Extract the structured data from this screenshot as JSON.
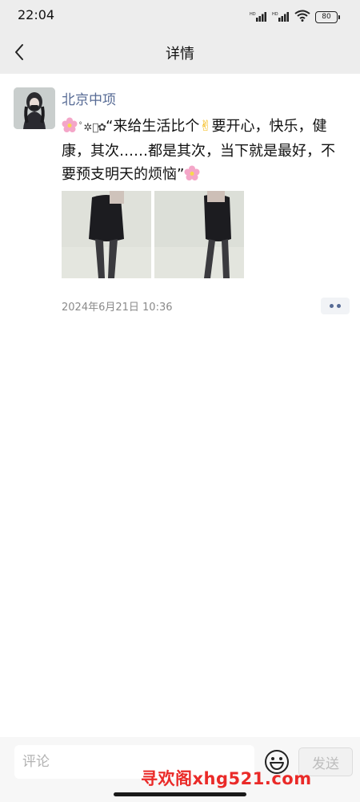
{
  "status_bar": {
    "time": "22:04",
    "signal1_label": "HD",
    "signal2_label": "HD",
    "battery_level": "80"
  },
  "nav": {
    "title": "详情",
    "back_icon": "chevron-left-icon"
  },
  "post": {
    "username": "北京中项",
    "text_quote_open": "“来给生活比个",
    "text_after_victory": "要开心，快乐，健康，其次……都是其次，当下就是最好，不要预支明天的烦恼”",
    "decorations": "ﾟ✲ﾟ✿",
    "emoji_icons": [
      "cherry-blossom-icon",
      "victory-hand-icon"
    ],
    "photo_count": 2,
    "timestamp": "2024年6月21日 10:36"
  },
  "comment_bar": {
    "placeholder": "评论",
    "send_label": "发送",
    "emoji_icon": "smiley-icon"
  },
  "watermark": "寻欢阁xhg521.com",
  "colors": {
    "username": "#576b95",
    "watermark": "#ea2a28",
    "background": "#ededed"
  }
}
